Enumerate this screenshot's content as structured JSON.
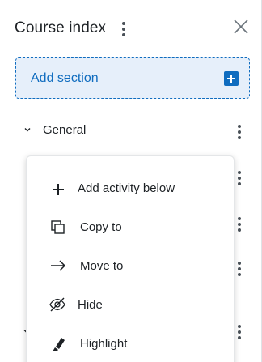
{
  "drawer": {
    "title": "Course index",
    "add_section_label": "Add section"
  },
  "section": {
    "title": "General"
  },
  "menu": {
    "items": [
      {
        "label": "Add activity below",
        "icon": "plus-icon"
      },
      {
        "label": "Copy to",
        "icon": "copy-icon"
      },
      {
        "label": "Move to",
        "icon": "arrow-right-icon"
      },
      {
        "label": "Hide",
        "icon": "eye-slash-icon"
      },
      {
        "label": "Highlight",
        "icon": "highlighter-icon"
      }
    ]
  },
  "colors": {
    "accent": "#0f6cbf",
    "accent_bg": "#e6effa",
    "text": "#1d2125"
  }
}
